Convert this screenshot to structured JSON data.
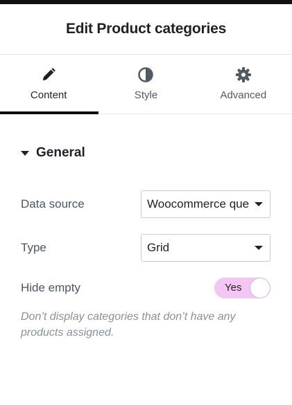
{
  "panel": {
    "title": "Edit Product categories"
  },
  "tabs": [
    {
      "label": "Content",
      "icon": "pencil-icon",
      "active": true
    },
    {
      "label": "Style",
      "icon": "contrast-icon",
      "active": false
    },
    {
      "label": "Advanced",
      "icon": "gear-icon",
      "active": false
    }
  ],
  "section": {
    "title": "General"
  },
  "fields": {
    "data_source": {
      "label": "Data source",
      "value": "Woocommerce query"
    },
    "type": {
      "label": "Type",
      "value": "Grid"
    },
    "hide_empty": {
      "label": "Hide empty",
      "value": "Yes",
      "on": true
    }
  },
  "description": "Don’t display categories that don’t have any products assigned.",
  "colors": {
    "switch_on": "#f3c6f3",
    "active_tab_bar": "#0c0d0e"
  }
}
